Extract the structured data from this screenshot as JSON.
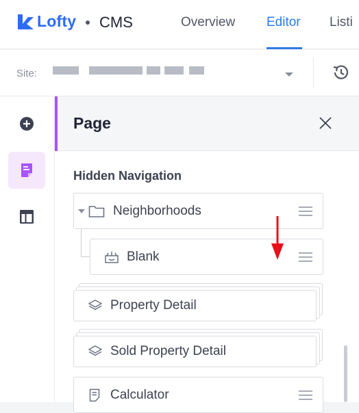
{
  "brand": {
    "name": "Lofty",
    "product": "CMS",
    "color": "#2c6cf6"
  },
  "nav": {
    "tabs": [
      {
        "label": "Overview"
      },
      {
        "label": "Editor",
        "active": true
      },
      {
        "label": "Listi"
      }
    ]
  },
  "site": {
    "label": "Site:",
    "value_redacted": true
  },
  "sidebar": {
    "items": [
      {
        "icon": "plus-circle-icon"
      },
      {
        "icon": "page-icon",
        "active": true
      },
      {
        "icon": "layout-icon"
      }
    ]
  },
  "panel": {
    "title": "Page",
    "section_title": "Hidden Navigation",
    "items": [
      {
        "label": "Neighborhoods",
        "icon": "folder-icon",
        "expanded": true
      },
      {
        "label": "Blank",
        "icon": "blank-page-icon",
        "child": true
      },
      {
        "label": "Property Detail",
        "icon": "layers-icon",
        "stacked": true
      },
      {
        "label": "Sold Property Detail",
        "icon": "layers-icon",
        "stacked": true
      },
      {
        "label": "Calculator",
        "icon": "document-icon"
      }
    ]
  },
  "colors": {
    "accent": "#2c7be5",
    "panel_accent": "#a855f7",
    "annotation_arrow": "#e8101a"
  }
}
